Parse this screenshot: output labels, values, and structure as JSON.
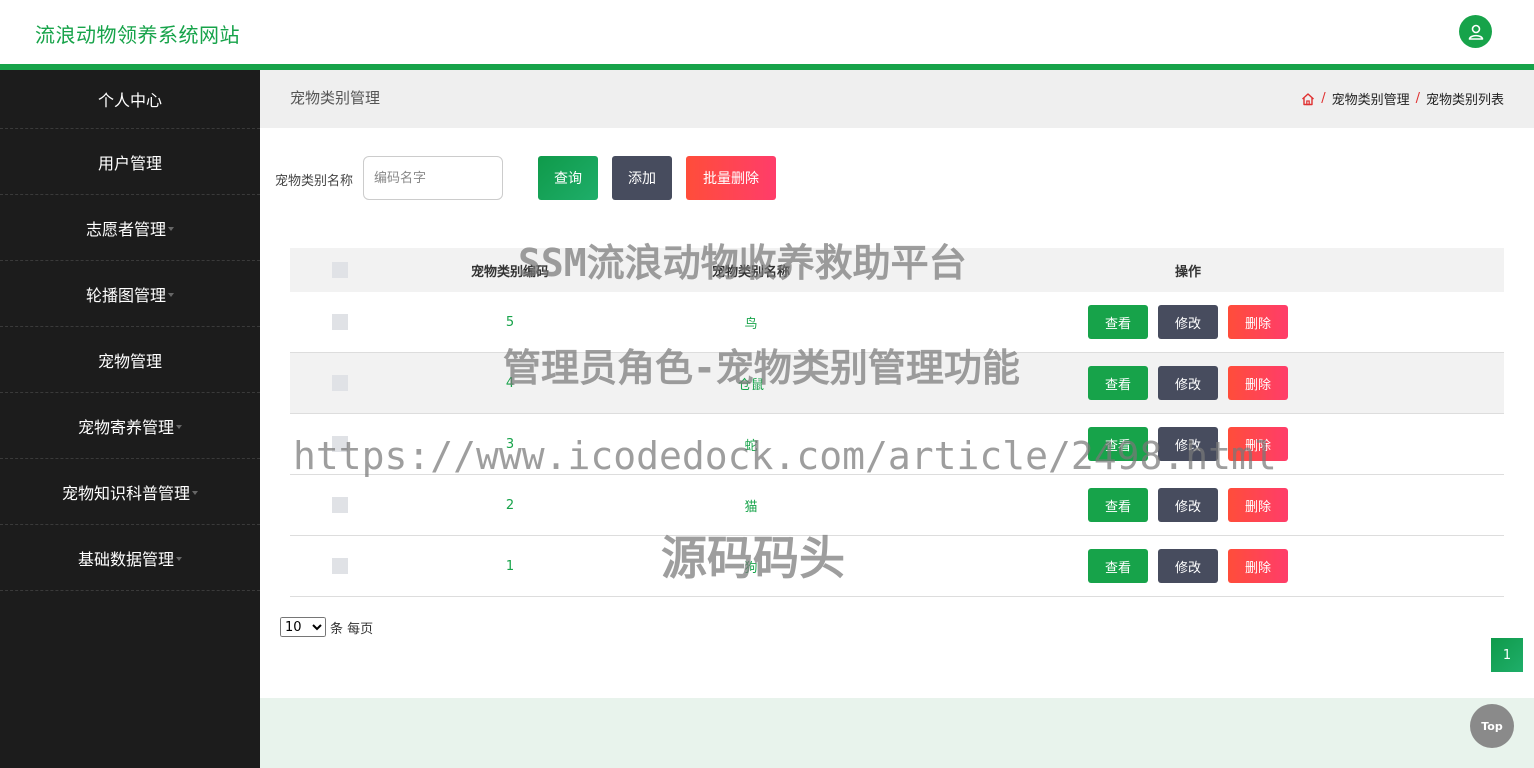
{
  "header": {
    "site_title": "流浪动物领养系统网站",
    "avatar_icon": "user-icon"
  },
  "colors": {
    "brand_green": "#17a34a",
    "sidebar_bg": "#1c1c1c",
    "edit_gray": "#474c5e",
    "delete_red": "#ff4d3a"
  },
  "sidebar": {
    "items": [
      {
        "label": "个人中心"
      },
      {
        "label": "用户管理"
      },
      {
        "label": "志愿者管理"
      },
      {
        "label": "轮播图管理"
      },
      {
        "label": "宠物管理"
      },
      {
        "label": "宠物寄养管理"
      },
      {
        "label": "宠物知识科普管理"
      },
      {
        "label": "基础数据管理"
      }
    ]
  },
  "page": {
    "title": "宠物类别管理",
    "breadcrumb": [
      "宠物类别管理",
      "宠物类别列表"
    ]
  },
  "search": {
    "label": "宠物类别名称",
    "placeholder": "编码名字",
    "query_label": "查询",
    "add_label": "添加",
    "batch_delete_label": "批量删除"
  },
  "table": {
    "headers": {
      "code": "宠物类别编码",
      "name": "宠物类别名称",
      "ops": "操作"
    },
    "rows": [
      {
        "code": "5",
        "name": "鸟"
      },
      {
        "code": "4",
        "name": "仓鼠"
      },
      {
        "code": "3",
        "name": "蛇"
      },
      {
        "code": "2",
        "name": "猫"
      },
      {
        "code": "1",
        "name": "狗"
      }
    ],
    "actions": {
      "view": "查看",
      "edit": "修改",
      "delete": "删除"
    }
  },
  "pager": {
    "page_size": "10",
    "per_page_label": "条 每页",
    "current_page": "1"
  },
  "top_button": "Top",
  "watermarks": [
    "SSM流浪动物收养救助平台",
    "管理员角色-宠物类别管理功能",
    "https://www.icodedock.com/article/2498.html",
    "源码码头"
  ]
}
